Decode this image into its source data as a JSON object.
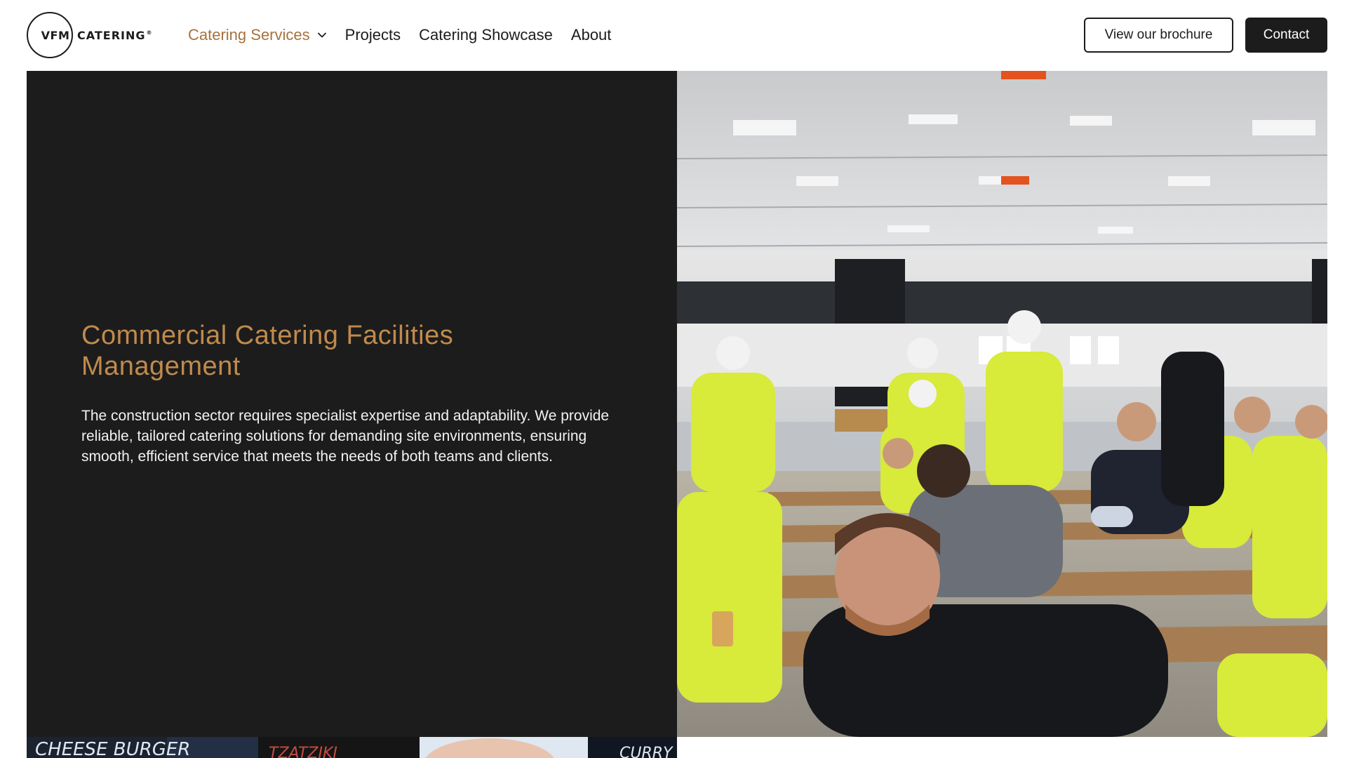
{
  "header": {
    "logo": {
      "mark": "VFM",
      "word": "CATERING",
      "reg": "®"
    },
    "nav": [
      {
        "label": "Catering Services",
        "active": true,
        "icon": "chevron-down-icon"
      },
      {
        "label": "Projects",
        "active": false
      },
      {
        "label": "Catering Showcase",
        "active": false
      },
      {
        "label": "About",
        "active": false
      }
    ],
    "brochure_label": "View our brochure",
    "contact_label": "Contact"
  },
  "hero": {
    "title_line1": "Commercial Catering Facilities",
    "title_line2": "Management",
    "body": "The construction sector requires specialist expertise and adaptability. We provide reliable, tailored catering solutions for demanding site environments, ensuring smooth, efficient service that meets the needs of both teams and clients.",
    "photo_alt": "Construction workers in high-visibility jackets eating in a site canteen"
  },
  "bottom_strip": {
    "board_text_1": "CHEESE BURGER",
    "board_text_2": "TZATZIKI",
    "board_text_3": "CURRY"
  },
  "colors": {
    "accent": "#a7723d",
    "title": "#c08a4d",
    "dark": "#1c1c1c",
    "white": "#ffffff",
    "hi_vis": "#d8ea3a"
  }
}
